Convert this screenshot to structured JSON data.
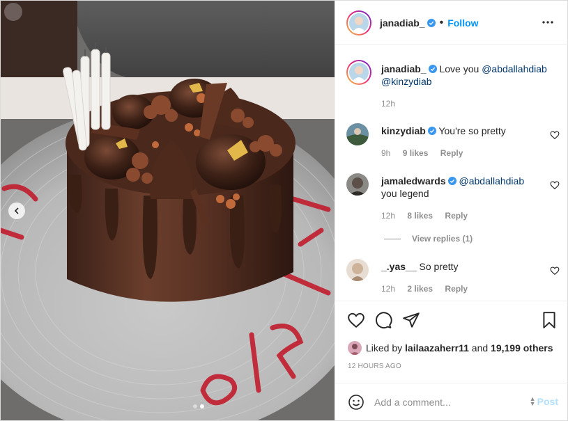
{
  "post": {
    "author": "janadiab_",
    "follow_label": "Follow",
    "caption": {
      "username": "janadiab_",
      "text": "Love you",
      "mentions": [
        "@abdallahdiab",
        "@kinzydiab"
      ],
      "age": "12h"
    },
    "comments": [
      {
        "username": "kinzydiab",
        "verified": true,
        "text": "You're so pretty",
        "mention": "",
        "age": "9h",
        "likes": "9 likes",
        "reply_label": "Reply"
      },
      {
        "username": "jamaledwards",
        "verified": true,
        "mention": "@abdallahdiab",
        "text": "you legend",
        "age": "12h",
        "likes": "8 likes",
        "reply_label": "Reply"
      },
      {
        "username": "_.yas__",
        "verified": false,
        "text": "So pretty",
        "mention": "",
        "age": "12h",
        "likes": "2 likes",
        "reply_label": "Reply"
      }
    ],
    "view_replies": "View replies (1)",
    "liked_by": {
      "prefix": "Liked by",
      "user": "lailaazaherr11",
      "conjunction": "and",
      "others": "19,199 others"
    },
    "timestamp": "12 HOURS AGO",
    "add_comment_placeholder": "Add a comment...",
    "post_label": "Post",
    "carousel": {
      "slides": 2,
      "active": 2
    }
  },
  "colors": {
    "accent": "#0095f6",
    "verified": "#3897f0",
    "post_disabled": "#b2dffc",
    "text": "#262626",
    "muted": "#8e8e8e"
  },
  "icons": [
    "more-options-icon",
    "heart-icon",
    "comment-icon",
    "share-icon",
    "bookmark-icon",
    "emoji-icon",
    "verified-badge-icon",
    "chevron-left-icon"
  ]
}
